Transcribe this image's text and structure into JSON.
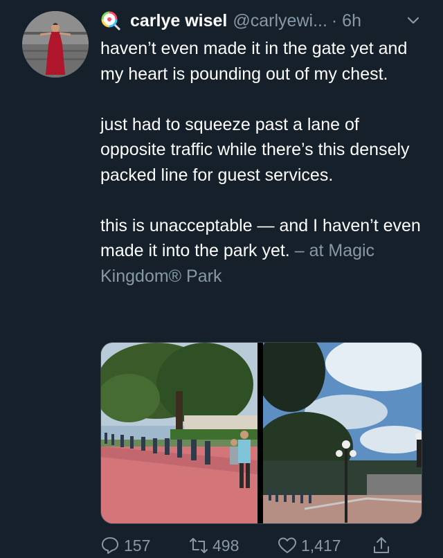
{
  "tweet": {
    "author_name": "carlye wisel",
    "author_handle": "@carlyewi...",
    "time": "· 6h",
    "body": [
      "haven’t even made it in the gate yet and my heart is pounding out of my chest.",
      "just had to squeeze past a lane of opposite traffic while there’s this densely packed line for guest services.",
      "this is unacceptable — and I haven’t even made it into the park yet."
    ],
    "location_text": "– at Magic Kingdom® Park",
    "counts": {
      "replies": "157",
      "retweets": "498",
      "likes": "1,417"
    }
  },
  "icons": {
    "badge": "lollipop-emoji-icon",
    "menu": "chevron-down-icon",
    "reply": "reply-icon",
    "retweet": "retweet-icon",
    "like": "heart-icon",
    "share": "share-icon"
  },
  "colors": {
    "background": "#15202b",
    "text": "#ffffff",
    "secondary": "#8899a6"
  }
}
